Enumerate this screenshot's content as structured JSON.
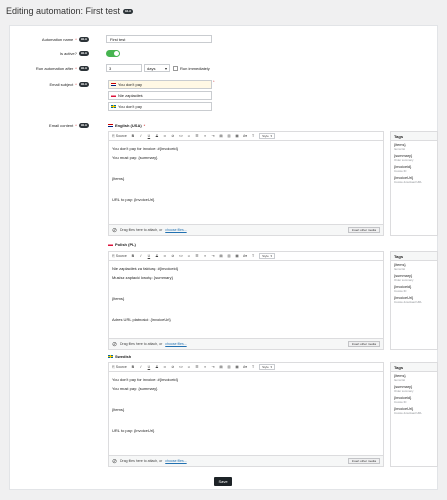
{
  "header": {
    "title": "Editing automation: First test",
    "help_badge": "HLA"
  },
  "form": {
    "name_label": "Automation name",
    "name_value": "First test",
    "active_label": "Is active?",
    "after_label": "Run automation after",
    "after_value": "3",
    "after_unit": "days",
    "run_immediately_label": "Run immediately",
    "subject_label": "Email subject",
    "subjects": [
      "You don't pay",
      "Nie zapłaciłeś",
      "You don't pay"
    ],
    "content_label": "Email content",
    "badge": "HLA"
  },
  "editors": [
    {
      "lang": "English (USA)",
      "lines": [
        "You don't pay for invoice: #{invoiceid}",
        "You must pay: {summary}",
        "{items}",
        "URL to pay: {invoiceUrl}"
      ]
    },
    {
      "lang": "Polish (PL)",
      "lines": [
        "Nie zapłaciłeś za fakturę: #{invoiceid}",
        "Musisz zapłacić kwotę: {summary}",
        "{items}",
        "Adres URL płatności: {invoiceUrl}"
      ]
    },
    {
      "lang": "Swedish",
      "lines": [
        "You don't pay for invoice: #{invoiceid}",
        "You must pay: {summary}",
        "{items}",
        "URL to pay: {invoiceUrl}"
      ]
    }
  ],
  "toolbar": {
    "source": "Source",
    "bold": "B",
    "italic": "I",
    "underline": "U",
    "strike": "S",
    "style_select": "Style"
  },
  "footer": {
    "drag_text": "Drag files here to attach, or",
    "choose_link": "choose files...",
    "insert_button": "Insert other media"
  },
  "tags": {
    "heading": "Tags",
    "items": [
      {
        "key": "{items}",
        "desc": "Items list"
      },
      {
        "key": "{summary}",
        "desc": "Order summary"
      },
      {
        "key": "{invoiceid}",
        "desc": "Invoice ID"
      },
      {
        "key": "{invoiceUrl}",
        "desc": "Invoice download URL"
      }
    ]
  },
  "save_label": "Save"
}
